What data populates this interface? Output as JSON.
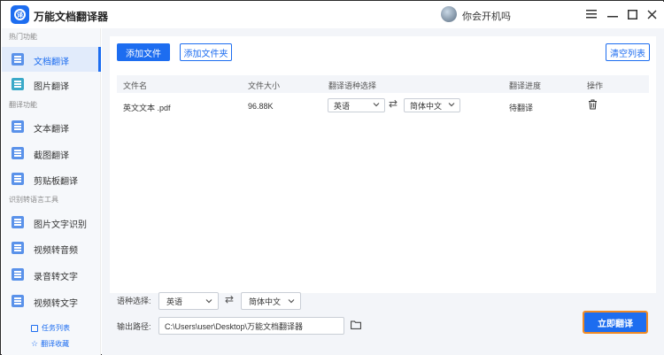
{
  "app": {
    "title": "万能文档翻译器",
    "logo_text": "译",
    "username": "你会开机吗",
    "controls": {
      "menu_icon": "menu-icon",
      "minimize_icon": "minimize-icon",
      "maximize_icon": "maximize-icon",
      "close_icon": "close-icon"
    }
  },
  "sidebar": {
    "sections": [
      {
        "label": "热门功能"
      },
      {
        "label": "翻译功能"
      },
      {
        "label": "识别转语言工具"
      }
    ],
    "items": [
      {
        "label": "文档翻译",
        "icon": "document-icon",
        "active": true
      },
      {
        "label": "图片翻译",
        "icon": "image-icon"
      },
      {
        "label": "文本翻译",
        "icon": "text-icon"
      },
      {
        "label": "截图翻译",
        "icon": "screenshot-icon"
      },
      {
        "label": "剪贴板翻译",
        "icon": "clipboard-icon"
      },
      {
        "label": "图片文字识别",
        "icon": "ocr-icon"
      },
      {
        "label": "视频转音频",
        "icon": "video-audio-icon"
      },
      {
        "label": "录音转文字",
        "icon": "record-icon"
      },
      {
        "label": "视频转文字",
        "icon": "video-text-icon"
      }
    ],
    "bottom_links": [
      {
        "label": "任务列表",
        "icon": "task-list-icon"
      },
      {
        "label": "翻译收藏",
        "icon": "star-icon"
      }
    ]
  },
  "toolbar": {
    "add_file": "添加文件",
    "add_folder": "添加文件夹",
    "clear_list": "清空列表"
  },
  "table": {
    "columns": [
      "文件名",
      "文件大小",
      "翻译语种选择",
      "翻译进度",
      "操作"
    ],
    "rows": [
      {
        "name": "英文文本 .pdf",
        "size": "96.88K",
        "source_lang": "英语",
        "target_lang": "简体中文",
        "progress": "待翻译",
        "action_icon": "trash-icon"
      }
    ]
  },
  "footer": {
    "lang_label": "语种选择:",
    "source_lang": "英语",
    "target_lang": "简体中文",
    "swap_icon": "swap-icon",
    "output_label": "输出路径:",
    "output_path": "C:\\Users\\user\\Desktop\\万能文档翻译器",
    "folder_icon": "folder-icon",
    "translate_button": "立即翻译"
  },
  "colors": {
    "accent": "#1d6df0",
    "highlight_border": "#f08a24"
  }
}
